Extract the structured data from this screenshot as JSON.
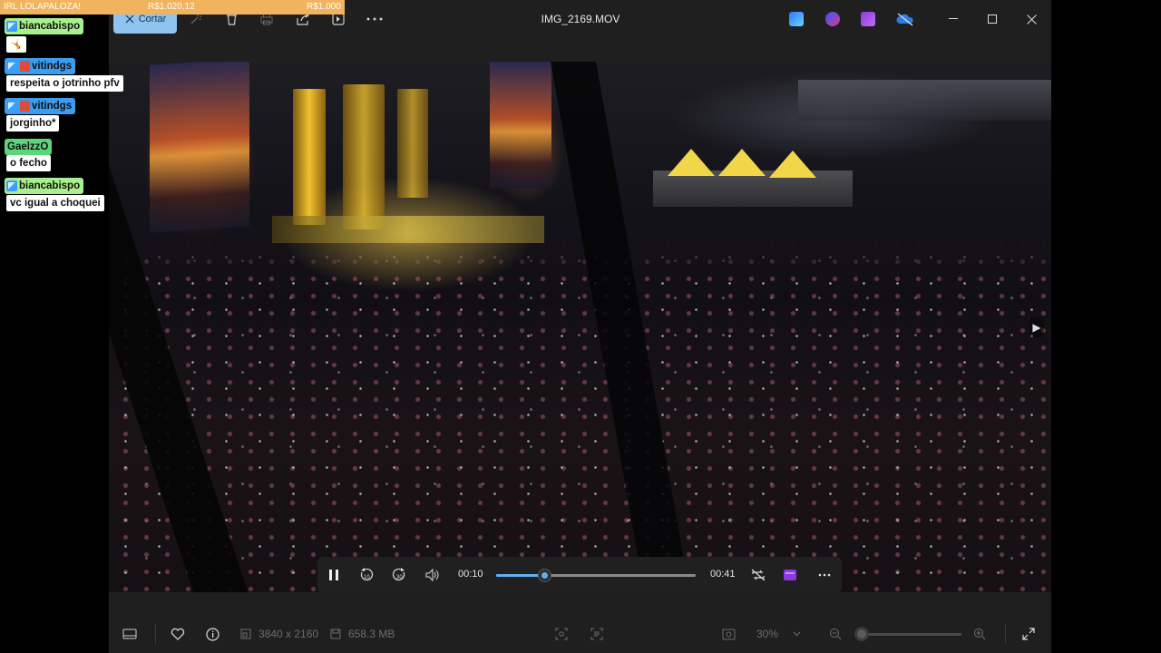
{
  "overlay": {
    "donation_bar": {
      "left_text": "IRL LOLAPALOZA!",
      "amount_1": "R$1.020,12",
      "amount_2": "R$1.000"
    },
    "chat": [
      {
        "user": "biancabispo",
        "message": "🤸",
        "user_color": "#a8f08c"
      },
      {
        "user": "vitindgs",
        "message": "respeita o jotrinho pfv",
        "user_color": "#3c9cf0"
      },
      {
        "user": "vitindgs",
        "message": "jorginho*",
        "user_color": "#3c9cf0"
      },
      {
        "user": "GaelzzO",
        "message": "o fecho",
        "user_color": "#5bd67a"
      },
      {
        "user": "biancabispo",
        "message": "vc igual a choquei",
        "user_color": "#a8f08c"
      }
    ]
  },
  "window": {
    "title": "IMG_2169.MOV",
    "toolbar": {
      "cut_label": "Cortar",
      "tools": [
        "enhance-icon",
        "delete-icon",
        "print-icon",
        "share-icon",
        "open-with-icon",
        "more-icon"
      ]
    },
    "app_icons": [
      "photoshop-express-icon",
      "clipchamp-icon",
      "onenote-icon",
      "onedrive-icon"
    ],
    "controls": [
      "minimize-icon",
      "maximize-icon",
      "close-icon"
    ]
  },
  "player": {
    "current_time": "00:10",
    "total_time": "00:41",
    "progress": 0.24
  },
  "bottom_bar": {
    "resolution": "3840 x 2160",
    "file_size": "658.3 MB",
    "zoom": "30%",
    "zoom_level": 0.05
  },
  "colors": {
    "accent": "#60b0f4",
    "cut_button_bg": "#8ec4ef",
    "window_bg": "#1f1f1f",
    "donation_bg": "#f1b35e"
  }
}
